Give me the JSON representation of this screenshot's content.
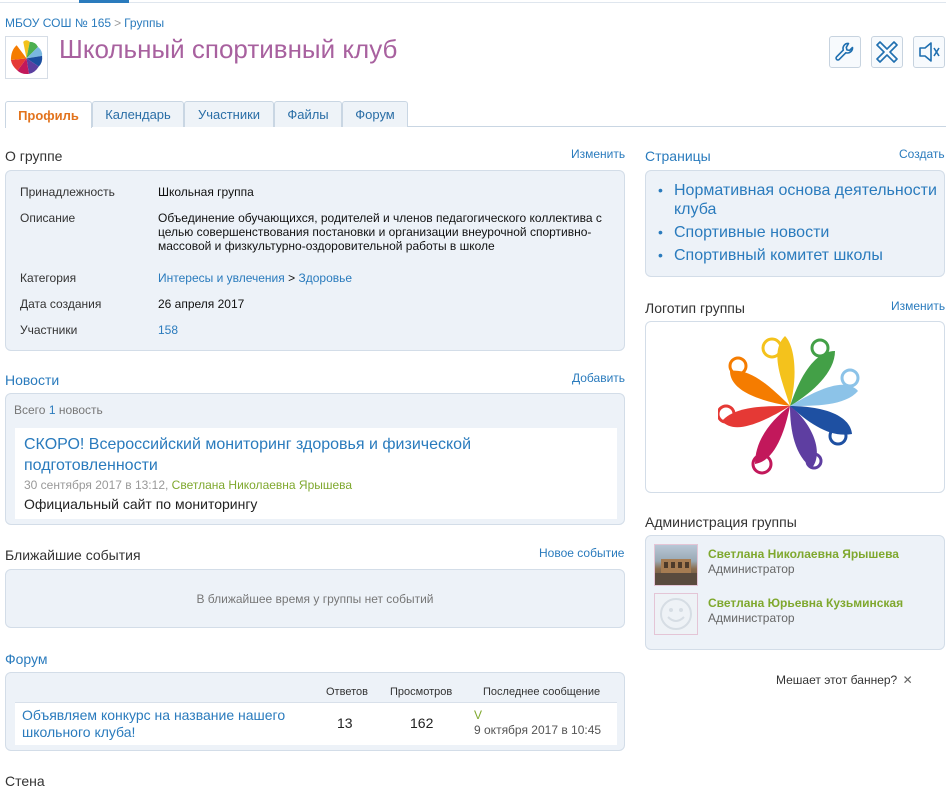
{
  "breadcrumb": {
    "home": "МБОУ СОШ № 165",
    "separator": ">",
    "current": "Группы"
  },
  "group": {
    "title": "Школьный спортивный клуб"
  },
  "toolbar": {
    "settings_icon": "wrench-icon",
    "leave_icon": "close-x-icon",
    "mute_icon": "speaker-mute-icon"
  },
  "tabs": [
    {
      "label": "Профиль",
      "active": true
    },
    {
      "label": "Календарь"
    },
    {
      "label": "Участники"
    },
    {
      "label": "Файлы"
    },
    {
      "label": "Форум"
    }
  ],
  "about": {
    "title": "О группе",
    "edit_link": "Изменить",
    "rows": {
      "affiliation_label": "Принадлежность",
      "affiliation_value": "Школьная группа",
      "description_label": "Описание",
      "description_value": "Объединение обучающихся, родителей и членов педагогического коллектива с целью совершенствования постановки и организации внеурочной спортивно-массовой и физкультурно-оздоровительной работы в школе",
      "category_label": "Категория",
      "category_value_1": "Интересы и увлечения",
      "category_sep": ">",
      "category_value_2": "Здоровье",
      "created_label": "Дата создания",
      "created_value": "26 апреля 2017",
      "members_label": "Участники",
      "members_value": "158"
    }
  },
  "news": {
    "title": "Новости",
    "add_link": "Добавить",
    "count_prefix": "Всего",
    "count_num": "1",
    "count_suffix": "новость",
    "item": {
      "title": "СКОРО! Всероссийский мониторинг здоровья и физической подготовленности",
      "date": "30 сентября 2017 в 13:12,",
      "author": "Светлана Николаевна Ярышева",
      "text": "Официальный сайт по мониторингу"
    }
  },
  "events": {
    "title": "Ближайшие события",
    "new_link": "Новое событие",
    "empty": "В ближайшее время у группы нет событий"
  },
  "forum": {
    "title": "Форум",
    "col_replies": "Ответов",
    "col_views": "Просмотров",
    "col_last": "Последнее сообщение",
    "topic": {
      "title": "Объявляем конкурс на название нашего школьного клуба!",
      "replies": "13",
      "views": "162",
      "last_author": "V",
      "last_date": "9 октября 2017 в 10:45"
    }
  },
  "wall": {
    "title": "Стена"
  },
  "pages": {
    "title": "Страницы",
    "create_link": "Создать",
    "items": [
      "Нормативная основа деятельности клуба",
      "Спортивные новости",
      "Спортивный комитет школы"
    ]
  },
  "logo": {
    "title": "Логотип группы",
    "edit_link": "Изменить"
  },
  "admins": {
    "title": "Администрация группы",
    "items": [
      {
        "name": "Светлана Николаевна Ярышева",
        "role": "Администратор"
      },
      {
        "name": "Светлана Юрьевна Кузьминская",
        "role": "Администратор"
      }
    ]
  },
  "banner": {
    "text": "Мешает этот баннер?",
    "close": "✕"
  }
}
